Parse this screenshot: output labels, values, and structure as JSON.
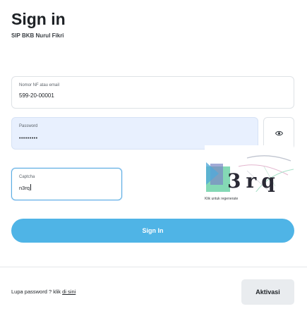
{
  "header": {
    "title": "Sign in",
    "subtitle": "SIP BKB Nurul Fikri"
  },
  "form": {
    "username": {
      "label": "Nomor NF atau email",
      "value": "599-20-00001"
    },
    "password": {
      "label": "Password",
      "value": "•••••••••"
    },
    "captcha": {
      "label": "Captcha",
      "value": "n3rq"
    },
    "captcha_image": {
      "text": "3rq",
      "hint": "Klik untuk regenerate"
    },
    "submit_label": "Sign In"
  },
  "footer": {
    "forgot_prefix": "Lupa password ? klik ",
    "forgot_link": "di sini",
    "activate_label": "Aktivasi"
  },
  "icons": {
    "password_toggle": "eye-icon"
  },
  "colors": {
    "primary": "#4fb4e6",
    "autofill_bg": "#e8f0fe",
    "focus_border": "#5aaee0",
    "secondary_bg": "#e9ecef"
  }
}
